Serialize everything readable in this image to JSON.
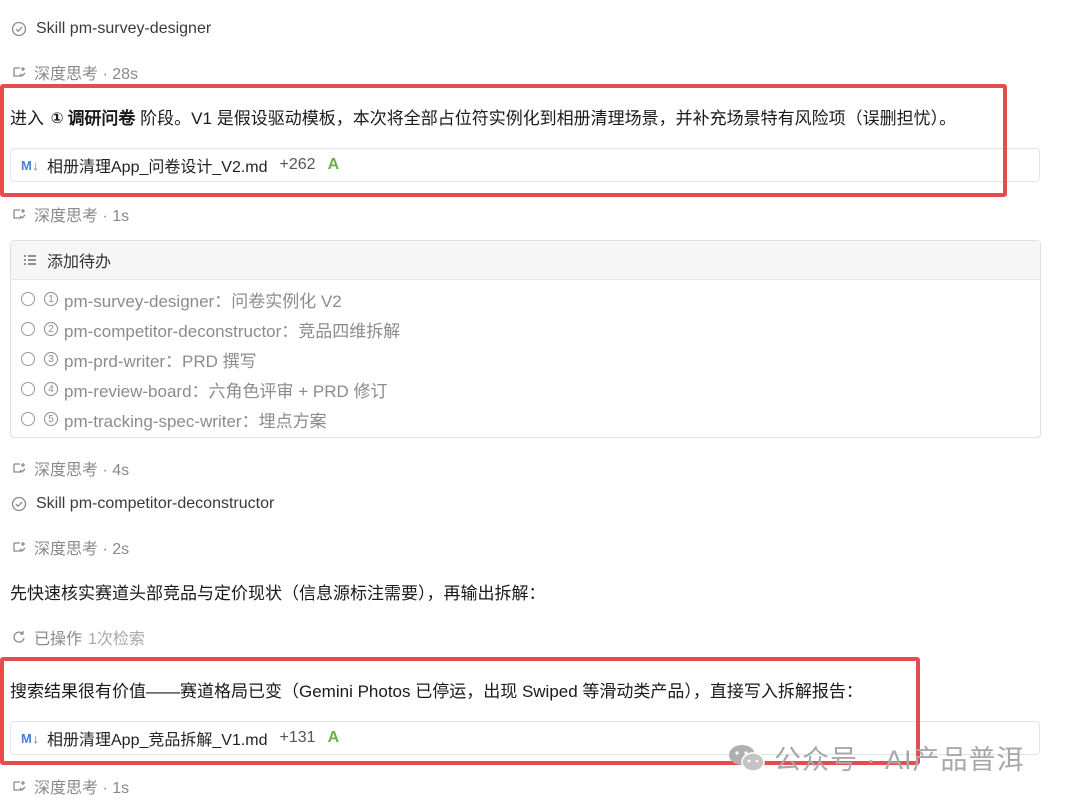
{
  "skill_1": {
    "prefix": "Skill",
    "name": "pm-survey-designer"
  },
  "thinking_1": "深度思考 · 28s",
  "para_1": {
    "before": "进入",
    "num": "①",
    "bold": "调研问卷",
    "after": "阶段。V1 是假设驱动模板，本次将全部占位符实例化到相册清理场景，并补充场景特有风险项（误删担忧）。"
  },
  "file_1": {
    "badge": "M↓",
    "name": "相册清理App_问卷设计_V2.md",
    "lines": "+262",
    "status": "A"
  },
  "thinking_2": "深度思考 · 1s",
  "todo": {
    "title": "添加待办",
    "items": [
      {
        "num": "1",
        "text": "pm-survey-designer：问卷实例化 V2"
      },
      {
        "num": "2",
        "text": "pm-competitor-deconstructor：竞品四维拆解"
      },
      {
        "num": "3",
        "text": "pm-prd-writer：PRD 撰写"
      },
      {
        "num": "4",
        "text": "pm-review-board：六角色评审 + PRD 修订"
      },
      {
        "num": "5",
        "text": "pm-tracking-spec-writer：埋点方案"
      }
    ]
  },
  "thinking_3": "深度思考 · 4s",
  "skill_2": {
    "prefix": "Skill",
    "name": "pm-competitor-deconstructor"
  },
  "thinking_4": "深度思考 · 2s",
  "para_2": "先快速核实赛道头部竞品与定价现状（信息源标注需要），再输出拆解：",
  "operated": {
    "label": "已操作",
    "detail": "1次检索"
  },
  "para_3": "搜索结果很有价值——赛道格局已变（Gemini Photos 已停运，出现 Swiped 等滑动类产品），直接写入拆解报告：",
  "file_2": {
    "badge": "M↓",
    "name": "相册清理App_竞品拆解_V1.md",
    "lines": "+131",
    "status": "A"
  },
  "thinking_5": "深度思考 · 1s",
  "watermark": "公众号 · AI产品普洱",
  "colors": {
    "highlight": "#e74c4c",
    "added": "#6cb04a",
    "md_badge": "#4a7fd4"
  }
}
